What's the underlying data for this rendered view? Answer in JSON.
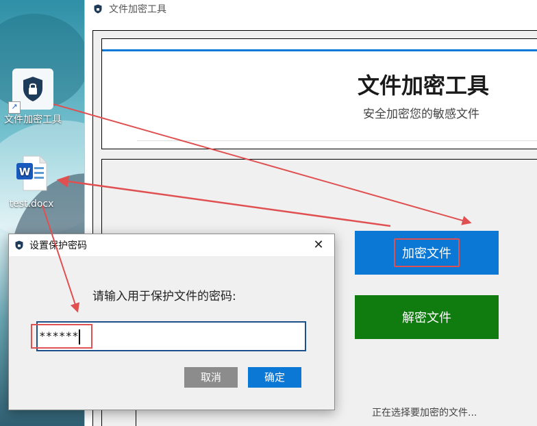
{
  "desktop": {
    "icons": [
      {
        "label": "文件加密工具",
        "icon": "shield-lock-icon"
      },
      {
        "label": "test.docx",
        "icon": "word-document-icon"
      }
    ]
  },
  "app_window": {
    "title": "文件加密工具",
    "header": {
      "title": "文件加密工具",
      "subtitle": "安全加密您的敏感文件"
    },
    "buttons": {
      "encrypt": "加密文件",
      "decrypt": "解密文件"
    },
    "status": "正在选择要加密的文件..."
  },
  "dialog": {
    "title": "设置保护密码",
    "close_glyph": "✕",
    "prompt": "请输入用于保护文件的密码:",
    "password_value": "******",
    "cancel_label": "取消",
    "ok_label": "确定"
  },
  "colors": {
    "accent_blue": "#0a78d4",
    "success_green": "#107c10",
    "annotation_red": "#e05050"
  }
}
